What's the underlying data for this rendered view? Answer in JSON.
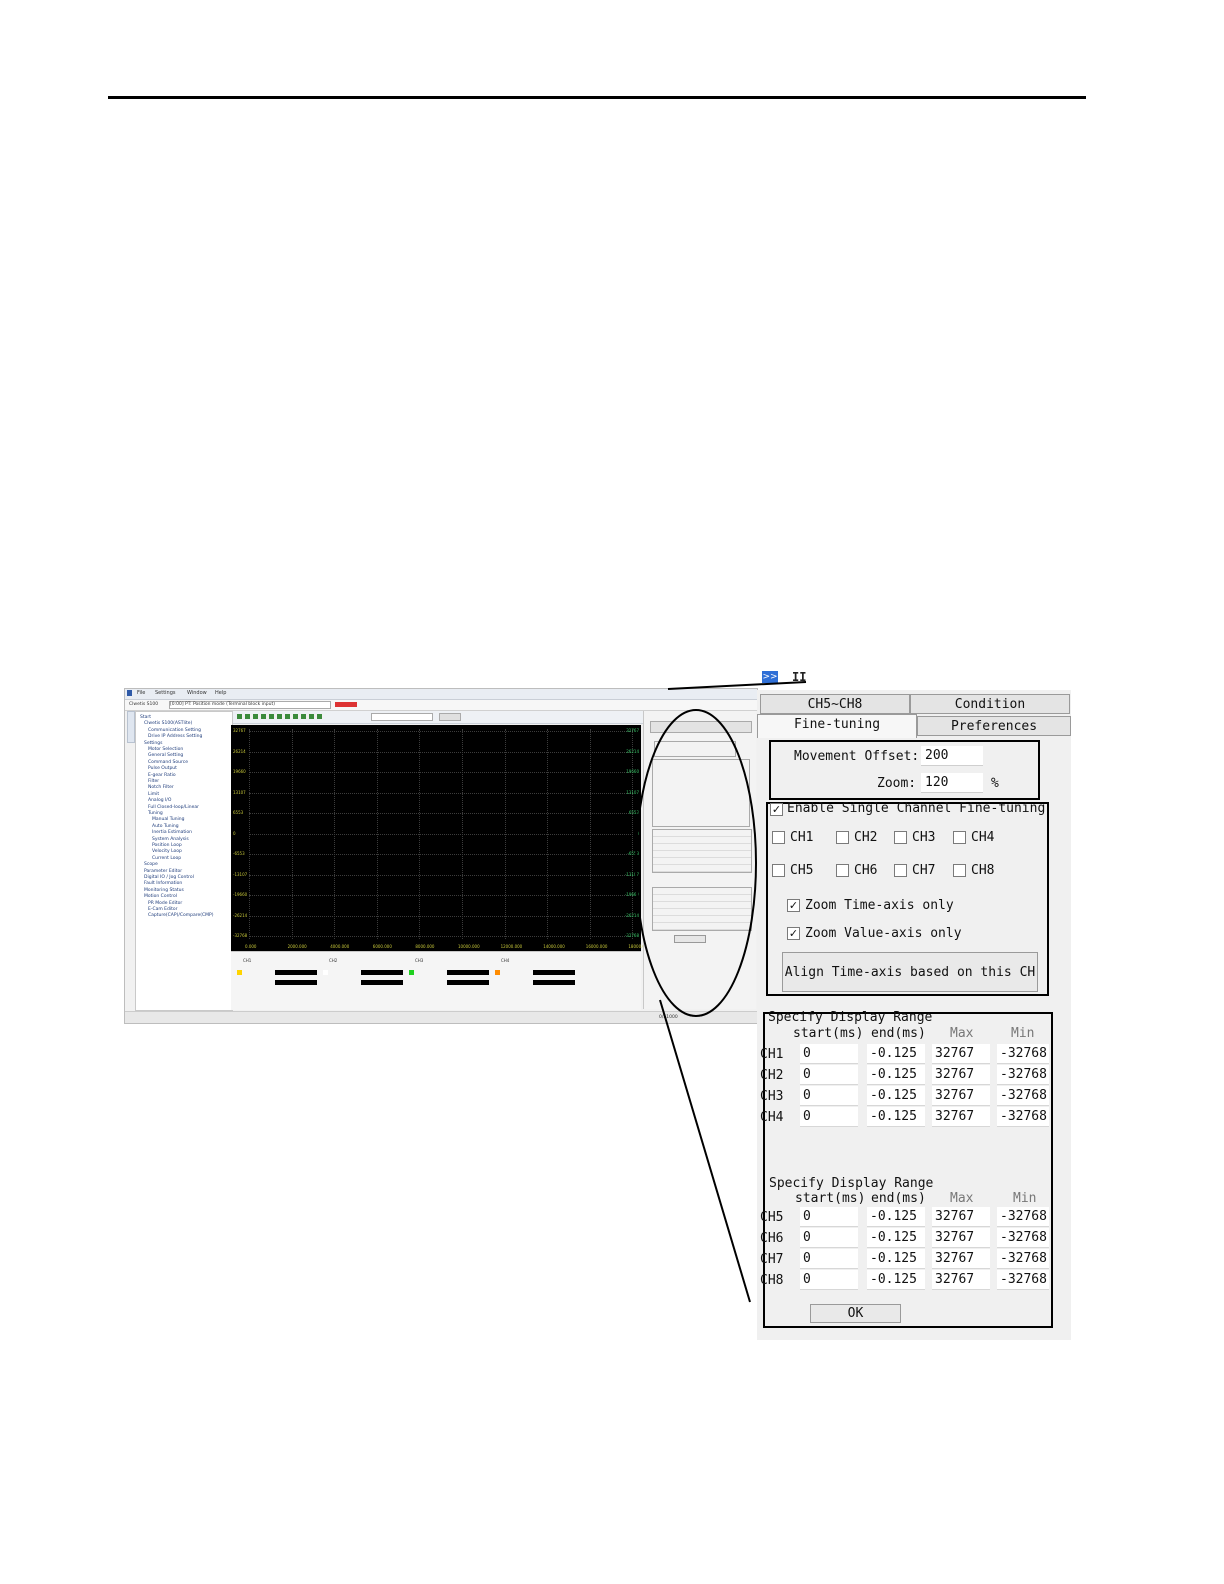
{
  "mini_app": {
    "menu": [
      "File",
      "Settings",
      "Window",
      "Help"
    ],
    "device": "Clwetis S100",
    "mode": "[0:00] PT: Position mode (Terminal block input)",
    "tree": [
      "Start",
      "Clwetis S100(ASTlite)",
      "Communication Setting",
      "Drive IP Address Setting",
      "Settings",
      "Motor Selection",
      "General Setting",
      "Command Source",
      "Pulse Output",
      "E-gear Ratio",
      "Filter",
      "Notch Filter",
      "Limit",
      "Analog I/O",
      "Full Closed-loop/Linear",
      "Tuning",
      "Manual Tuning",
      "Auto Tuning",
      "Inertia Estimation",
      "System Analysis",
      "Position Loop",
      "Velocity Loop",
      "Current Loop",
      "Scope",
      "Parameter Editor",
      "Digital IO / Jog Control",
      "Fault Information",
      "Monitoring Status",
      "Motion Control",
      "PR Mode Editor",
      "E-Cam Editor",
      "Capture(CAP)/Compare(CMP)"
    ],
    "y_ticks": [
      "32767",
      "26214",
      "19660",
      "13107",
      "6553",
      "0",
      "-6553",
      "-13107",
      "-19660",
      "-26214",
      "-32768"
    ],
    "x_ticks": [
      "0.000",
      "2000.000",
      "4000.000",
      "6000.000",
      "8000.000",
      "10000.000",
      "12000.000",
      "14000.000",
      "16000.000",
      "18000.000"
    ],
    "bottom_channels": [
      "CH1",
      "CH2",
      "CH3",
      "CH4"
    ],
    "status": "0/51000"
  },
  "panel": {
    "tabs": {
      "top_left": "CH5~CH8",
      "top_right": "Condition",
      "bottom_left": "Fine-tuning",
      "bottom_right": "Preferences"
    },
    "movement_offset_label": "Movement Offset:",
    "movement_offset_value": "200",
    "zoom_label": "Zoom:",
    "zoom_value": "120",
    "zoom_unit": "%",
    "enable_single_label": "Enable Single Channel Fine-tuning",
    "enable_single_checked": true,
    "channels": [
      "CH1",
      "CH2",
      "CH3",
      "CH4",
      "CH5",
      "CH6",
      "CH7",
      "CH8"
    ],
    "zoom_time_label": "Zoom Time-axis only",
    "zoom_time_checked": true,
    "zoom_value_label": "Zoom Value-axis only",
    "zoom_value_checked": true,
    "align_button": "Align Time-axis based on this CH",
    "range1": {
      "title": "Specify Display Range",
      "headers": [
        "start(ms)",
        "end(ms)",
        "Max",
        "Min"
      ],
      "rows": [
        {
          "ch": "CH1",
          "start": "0",
          "end": "-0.125",
          "max": "32767",
          "min": "-32768"
        },
        {
          "ch": "CH2",
          "start": "0",
          "end": "-0.125",
          "max": "32767",
          "min": "-32768"
        },
        {
          "ch": "CH3",
          "start": "0",
          "end": "-0.125",
          "max": "32767",
          "min": "-32768"
        },
        {
          "ch": "CH4",
          "start": "0",
          "end": "-0.125",
          "max": "32767",
          "min": "-32768"
        }
      ]
    },
    "range2": {
      "title": "Specify Display Range",
      "headers": [
        "start(ms)",
        "end(ms)",
        "Max",
        "Min"
      ],
      "rows": [
        {
          "ch": "CH5",
          "start": "0",
          "end": "-0.125",
          "max": "32767",
          "min": "-32768"
        },
        {
          "ch": "CH6",
          "start": "0",
          "end": "-0.125",
          "max": "32767",
          "min": "-32768"
        },
        {
          "ch": "CH7",
          "start": "0",
          "end": "-0.125",
          "max": "32767",
          "min": "-32768"
        },
        {
          "ch": "CH8",
          "start": "0",
          "end": "-0.125",
          "max": "32767",
          "min": "-32768"
        }
      ]
    },
    "ok_button": "OK"
  },
  "icons": {
    "expand": ">>",
    "pause": "II"
  }
}
